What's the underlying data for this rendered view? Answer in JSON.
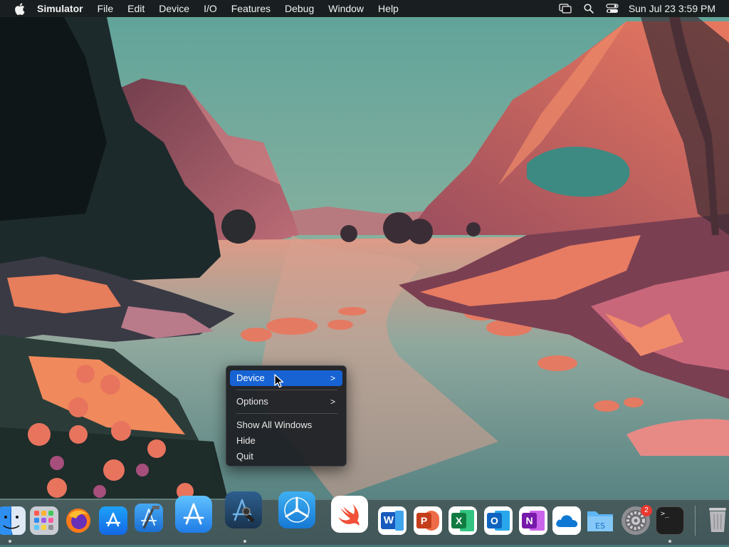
{
  "menubar": {
    "app_name": "Simulator",
    "menus": [
      "File",
      "Edit",
      "Device",
      "I/O",
      "Features",
      "Debug",
      "Window",
      "Help"
    ],
    "status_icons": [
      "screen-mirroring-icon",
      "spotlight-search-icon",
      "control-center-icon"
    ],
    "clock": "Sun Jul 23  3:59 PM"
  },
  "context_menu": {
    "items": [
      {
        "label": "Device",
        "submenu": true,
        "highlighted": true
      },
      {
        "label": "Options",
        "submenu": true,
        "highlighted": false
      },
      {
        "label": "Show All Windows",
        "submenu": false,
        "highlighted": false
      },
      {
        "label": "Hide",
        "submenu": false,
        "highlighted": false
      },
      {
        "label": "Quit",
        "submenu": false,
        "highlighted": false
      }
    ],
    "submenu_glyph": ">"
  },
  "dock": {
    "apps": [
      {
        "name": "Finder",
        "icon": "finder-icon",
        "running": true
      },
      {
        "name": "Launchpad",
        "icon": "launchpad-icon",
        "running": false
      },
      {
        "name": "Firefox",
        "icon": "firefox-icon",
        "running": false
      },
      {
        "name": "App Store",
        "icon": "app-store-icon",
        "running": false
      },
      {
        "name": "Xcode",
        "icon": "xcode-icon",
        "running": false
      },
      {
        "name": "Simulator",
        "icon": "simulator-icon",
        "running": false
      },
      {
        "name": "Instruments",
        "icon": "instruments-icon",
        "running": true
      },
      {
        "name": "TestFlight",
        "icon": "testflight-icon",
        "running": false
      },
      {
        "name": "Swift Playgrounds",
        "icon": "swift-icon",
        "running": false
      },
      {
        "name": "Microsoft Word",
        "icon": "word-icon",
        "running": false
      },
      {
        "name": "Microsoft PowerPoint",
        "icon": "powerpoint-icon",
        "running": false
      },
      {
        "name": "Microsoft Excel",
        "icon": "excel-icon",
        "running": false
      },
      {
        "name": "Microsoft Outlook",
        "icon": "outlook-icon",
        "running": false
      },
      {
        "name": "Microsoft OneNote",
        "icon": "onenote-icon",
        "running": false
      },
      {
        "name": "OneDrive",
        "icon": "onedrive-icon",
        "running": false
      },
      {
        "name": "Folder",
        "icon": "folder-icon",
        "running": false
      },
      {
        "name": "System Settings",
        "icon": "settings-icon",
        "running": false,
        "badge": "2"
      },
      {
        "name": "Terminal",
        "icon": "terminal-icon",
        "running": true
      },
      {
        "name": "Trash",
        "icon": "trash-icon",
        "running": false
      }
    ],
    "labels": {
      "word_letter": "W",
      "powerpoint_letter": "P",
      "excel_letter": "X",
      "outlook_letter": "O",
      "onenote_letter": "N",
      "terminal_prompt": ">_"
    }
  },
  "colors": {
    "highlight": "#1763d4",
    "menubar_bg": "#141416",
    "badge": "#e8392f"
  }
}
